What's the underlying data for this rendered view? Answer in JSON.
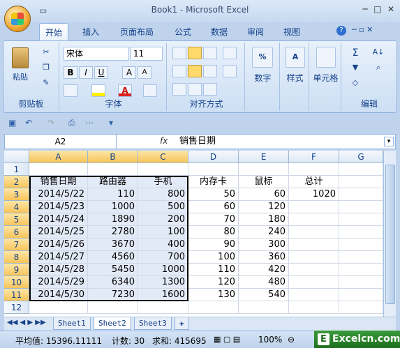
{
  "window": {
    "title": "Book1 - Microsoft Excel"
  },
  "tabs": [
    "开始",
    "插入",
    "页面布局",
    "公式",
    "数据",
    "审阅",
    "视图"
  ],
  "ribbon": {
    "clipboard": {
      "label": "剪贴板",
      "paste": "粘贴"
    },
    "font": {
      "label": "字体",
      "name": "宋体",
      "size": "11"
    },
    "align": {
      "label": "对齐方式"
    },
    "number": {
      "label": "数字"
    },
    "style": {
      "label": "样式"
    },
    "cells": {
      "label": "单元格"
    },
    "edit": {
      "label": "编辑"
    }
  },
  "formula": {
    "namebox": "A2",
    "fx": "fx",
    "content": "销售日期"
  },
  "columns": [
    "A",
    "B",
    "C",
    "D",
    "E",
    "F",
    "G"
  ],
  "rows": [
    "1",
    "2",
    "3",
    "4",
    "5",
    "6",
    "7",
    "8",
    "9",
    "10",
    "11",
    "12"
  ],
  "cells": {
    "r2": [
      "销售日期",
      "路由器",
      "手机",
      "内存卡",
      "鼠标",
      "总计"
    ],
    "data": [
      [
        "2014/5/22",
        "110",
        "800",
        "50",
        "60",
        "1020"
      ],
      [
        "2014/5/23",
        "1000",
        "500",
        "60",
        "120",
        ""
      ],
      [
        "2014/5/24",
        "1890",
        "200",
        "70",
        "180",
        ""
      ],
      [
        "2014/5/25",
        "2780",
        "100",
        "80",
        "240",
        ""
      ],
      [
        "2014/5/26",
        "3670",
        "400",
        "90",
        "300",
        ""
      ],
      [
        "2014/5/27",
        "4560",
        "700",
        "100",
        "360",
        ""
      ],
      [
        "2014/5/28",
        "5450",
        "1000",
        "110",
        "420",
        ""
      ],
      [
        "2014/5/29",
        "6340",
        "1300",
        "120",
        "480",
        ""
      ],
      [
        "2014/5/30",
        "7230",
        "1600",
        "130",
        "540",
        ""
      ]
    ]
  },
  "sheets": [
    "Sheet1",
    "Sheet2",
    "Sheet3"
  ],
  "status": {
    "average": "平均值: 15396.11111",
    "count": "计数: 30",
    "sum": "求和: 415695",
    "zoom": "100%"
  },
  "brand": {
    "letter": "E",
    "text": "Excelcn.com"
  }
}
